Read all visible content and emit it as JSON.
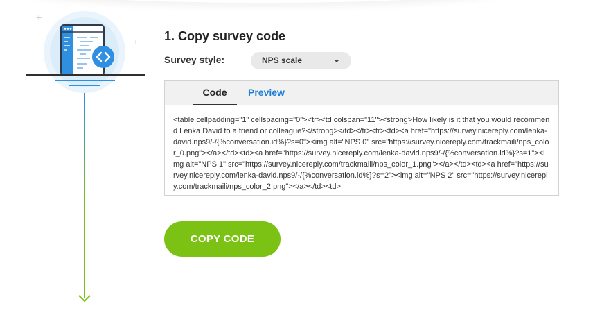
{
  "step": {
    "title": "1. Copy survey code"
  },
  "survey_style": {
    "label": "Survey style:",
    "selected": "NPS scale"
  },
  "tabs": [
    {
      "label": "Code",
      "active": true
    },
    {
      "label": "Preview",
      "active": false
    }
  ],
  "code_snippet": "<table cellpadding=\"1\" cellspacing=\"0\"><tr><td colspan=\"11\"><strong>How likely is it that you would recommend Lenka David to a friend or colleague?</strong></td></tr><tr><td><a href=\"https://survey.nicereply.com/lenka-david.nps9/-/{%conversation.id%}?s=0\"><img alt=\"NPS 0\" src=\"https://survey.nicereply.com/trackmaili/nps_color_0.png\"></a></td><td><a href=\"https://survey.nicereply.com/lenka-david.nps9/-/{%conversation.id%}?s=1\"><img alt=\"NPS 1\" src=\"https://survey.nicereply.com/trackmaili/nps_color_1.png\"></a></td><td><a href=\"https://survey.nicereply.com/lenka-david.nps9/-/{%conversation.id%}?s=2\"><img alt=\"NPS 2\" src=\"https://survey.nicereply.com/trackmaili/nps_color_2.png\"></a></td><td>",
  "copy_button": {
    "label": "COPY CODE"
  },
  "colors": {
    "accent_green": "#7cc215",
    "link_blue": "#1f7fd6",
    "illustration_blue": "#2f8fe0"
  },
  "icons": {
    "illustration": "code-document-icon",
    "badge": "code-brackets-icon",
    "flow_arrow": "arrow-down-icon"
  }
}
